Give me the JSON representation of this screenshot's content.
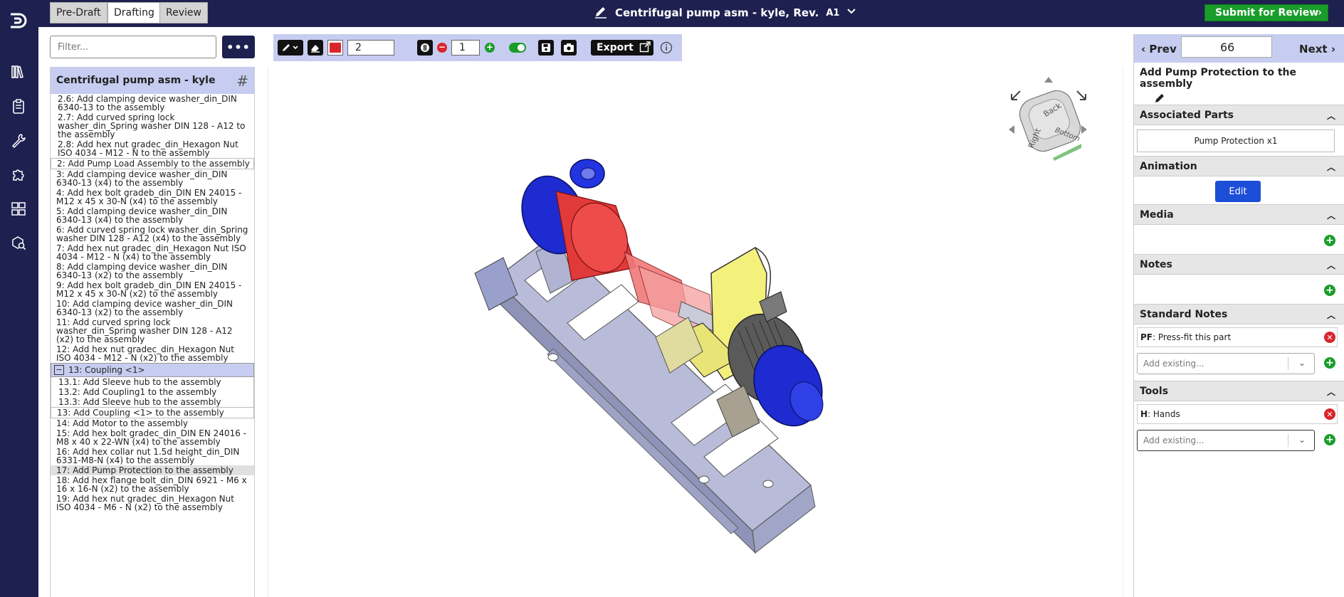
{
  "topbar": {
    "stages": [
      "Pre-Draft",
      "Drafting",
      "Review"
    ],
    "active_stage": "Drafting",
    "doc_title": "Centrifugal pump asm - kyle, Rev.",
    "revision": "A1",
    "submit_label": "Submit for Review"
  },
  "left": {
    "filter_placeholder": "Filter...",
    "more_label": "•••",
    "assembly_title": "Centrifugal pump asm - kyle",
    "steps": [
      {
        "text": "2.6: Add clamping device washer_din_DIN 6340-13 to the assembly",
        "kind": "sub"
      },
      {
        "text": "2.7: Add curved spring lock washer_din_Spring washer DIN 128 - A12 to the assembly",
        "kind": "sub"
      },
      {
        "text": "2.8: Add hex nut gradec_din_Hexagon Nut ISO 4034 - M12 - N to the assembly",
        "kind": "sub"
      },
      {
        "text": "2: Add Pump Load Assembly to the assembly",
        "kind": "boxed"
      },
      {
        "text": "3: Add clamping device washer_din_DIN 6340-13 (x4) to the assembly",
        "kind": "normal"
      },
      {
        "text": "4: Add hex bolt gradeb_din_DIN EN 24015 - M12 x 45 x 30-N (x4) to the assembly",
        "kind": "normal"
      },
      {
        "text": "5: Add clamping device washer_din_DIN 6340-13 (x4) to the assembly",
        "kind": "normal"
      },
      {
        "text": "6: Add curved spring lock washer_din_Spring washer DIN 128 - A12 (x4) to the assembly",
        "kind": "normal"
      },
      {
        "text": "7: Add hex nut gradec_din_Hexagon Nut ISO 4034 - M12 - N (x4) to the assembly",
        "kind": "normal"
      },
      {
        "text": "8: Add clamping device washer_din_DIN 6340-13 (x2) to the assembly",
        "kind": "normal"
      },
      {
        "text": "9: Add hex bolt gradeb_din_DIN EN 24015 - M12 x 45 x 30-N (x2) to the assembly",
        "kind": "normal"
      },
      {
        "text": "10: Add clamping device washer_din_DIN 6340-13 (x2) to the assembly",
        "kind": "normal"
      },
      {
        "text": "11: Add curved spring lock washer_din_Spring washer DIN 128 - A12 (x2) to the assembly",
        "kind": "normal"
      },
      {
        "text": "12: Add hex nut gradec_din_Hexagon Nut ISO 4034 - M12 - N (x2) to the assembly",
        "kind": "normal"
      },
      {
        "text": "13: Coupling <1>",
        "kind": "group"
      },
      {
        "text": "13.1: Add Sleeve hub to the assembly",
        "kind": "sub-inner"
      },
      {
        "text": "13.2: Add Coupling1 to the assembly",
        "kind": "sub-inner"
      },
      {
        "text": "13.3: Add Sleeve hub to the assembly",
        "kind": "sub-inner"
      },
      {
        "text": "13: Add Coupling <1> to the assembly",
        "kind": "boxed"
      },
      {
        "text": "14: Add Motor to the assembly",
        "kind": "normal"
      },
      {
        "text": "15: Add hex bolt gradec_din_DIN EN 24016 - M8 x 40 x 22-WN (x4) to the assembly",
        "kind": "normal"
      },
      {
        "text": "16: Add hex collar nut 1.5d height_din_DIN 6331-M8-N (x4) to the assembly",
        "kind": "normal"
      },
      {
        "text": "17: Add Pump Protection to the assembly",
        "kind": "selected"
      },
      {
        "text": "18: Add hex flange bolt_din_DIN 6921 - M6 x 16 x 16-N (x2) to the assembly",
        "kind": "normal"
      },
      {
        "text": "19: Add hex nut gradec_din_Hexagon Nut ISO 4034 - M6 - N (x2) to the assembly",
        "kind": "normal"
      }
    ]
  },
  "toolbar": {
    "color": "#d9252b",
    "stroke_width": "2",
    "counter_value": "1",
    "export_label": "Export"
  },
  "viewcube": {
    "face_back": "Back",
    "face_right": "Right",
    "face_bottom": "Bottom"
  },
  "right": {
    "prev_label": "Prev",
    "next_label": "Next",
    "step_number": "66",
    "step_title": "Add Pump Protection to the assembly",
    "sections": {
      "associated_parts": "Associated Parts",
      "animation": "Animation",
      "media": "Media",
      "notes": "Notes",
      "standard_notes": "Standard Notes",
      "tools": "Tools"
    },
    "part_chip": "Pump Protection x1",
    "edit_label": "Edit",
    "standard_note": {
      "code": "PF",
      "text": ": Press-fit this part"
    },
    "tool": {
      "code": "H",
      "text": ": Hands"
    },
    "add_existing_placeholder": "Add existing..."
  }
}
